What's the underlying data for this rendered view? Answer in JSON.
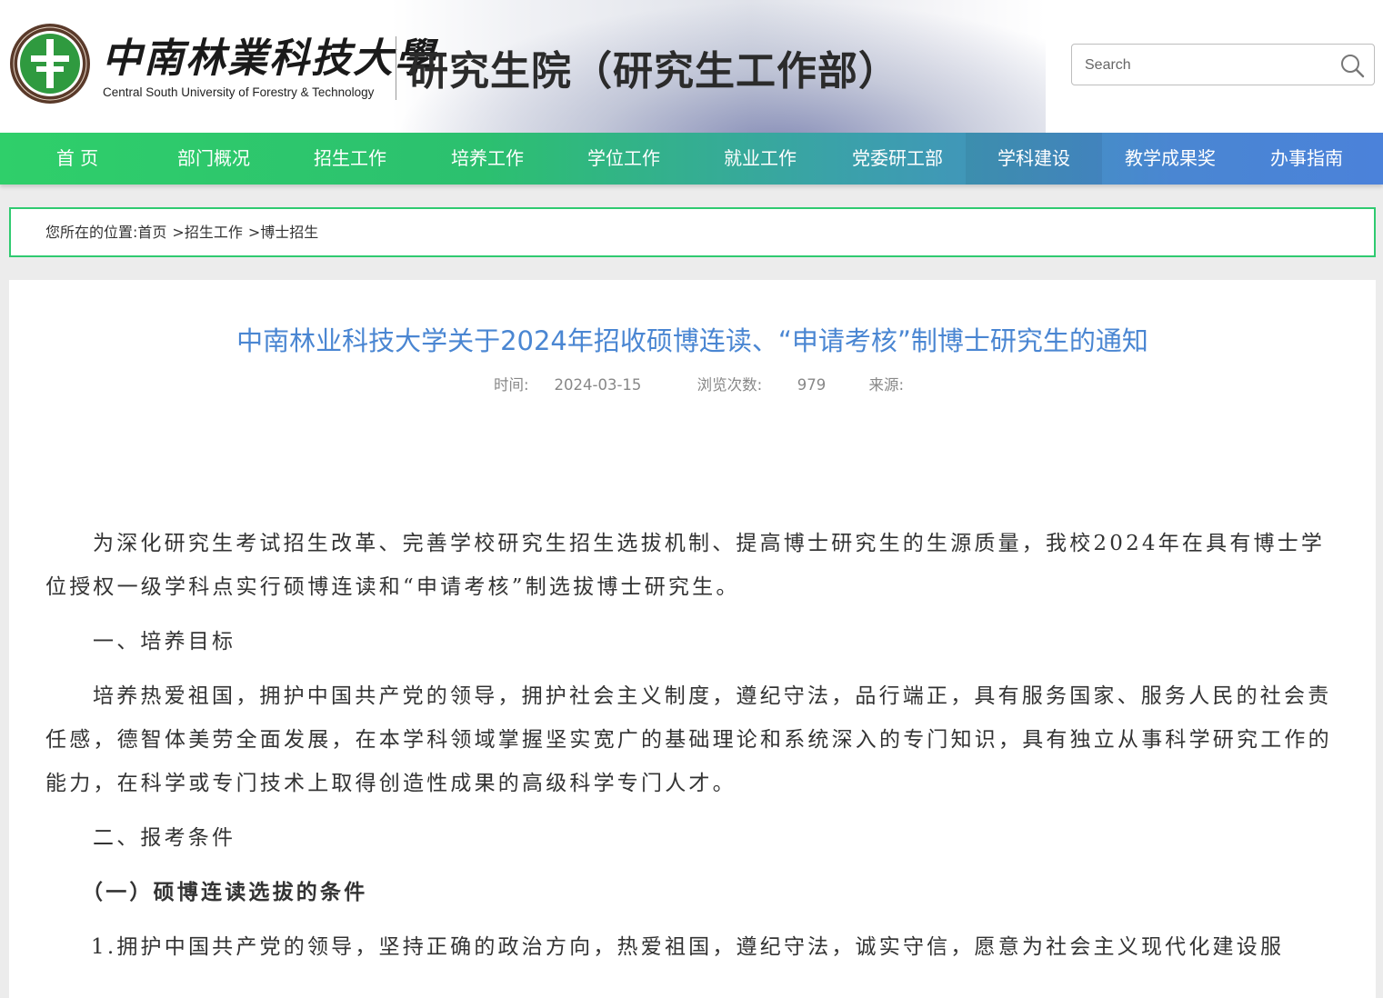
{
  "header": {
    "logo_cn": "中南林業科技大學",
    "logo_en": "Central South University of Forestry & Technology",
    "site_title": "研究生院（研究生工作部）",
    "search_placeholder": "Search"
  },
  "nav": {
    "items": [
      "首 页",
      "部门概况",
      "招生工作",
      "培养工作",
      "学位工作",
      "就业工作",
      "党委研工部",
      "学科建设",
      "教学成果奖",
      "办事指南"
    ]
  },
  "breadcrumb": {
    "prefix": "您所在的位置:",
    "items": [
      "首页",
      "招生工作",
      "博士招生"
    ],
    "separator": ">"
  },
  "article": {
    "title": "中南林业科技大学关于2024年招收硕博连读、“申请考核”制博士研究生的通知",
    "meta": {
      "time_label": "时间:",
      "time_value": "2024-03-15",
      "views_label": "浏览次数:",
      "views_value": "979",
      "source_label": "来源:"
    },
    "paragraphs": {
      "intro": "为深化研究生考试招生改革、完善学校研究生招生选拔机制、提高博士研究生的生源质量，我校2024年在具有博士学位授权一级学科点实行硕博连读和“申请考核”制选拔博士研究生。",
      "h1": "一、培养目标",
      "goal": "培养热爱祖国，拥护中国共产党的领导，拥护社会主义制度，遵纪守法，品行端正，具有服务国家、服务人民的社会责任感，德智体美劳全面发展，在本学科领域掌握坚实宽广的基础理论和系统深入的专门知识，具有独立从事科学研究工作的能力，在科学或专门技术上取得创造性成果的高级科学专门人才。",
      "h2": "二、报考条件",
      "h3": "（一）硕博连读选拔的条件",
      "item1": "1.拥护中国共产党的领导，坚持正确的政治方向，热爱祖国，遵纪守法，诚实守信，愿意为社会主义现代化建设服"
    }
  },
  "colors": {
    "nav_start": "#2fcf6a",
    "nav_end": "#4b82da",
    "title_blue": "#4a86d2",
    "breadcrumb_border": "#2fca70"
  }
}
